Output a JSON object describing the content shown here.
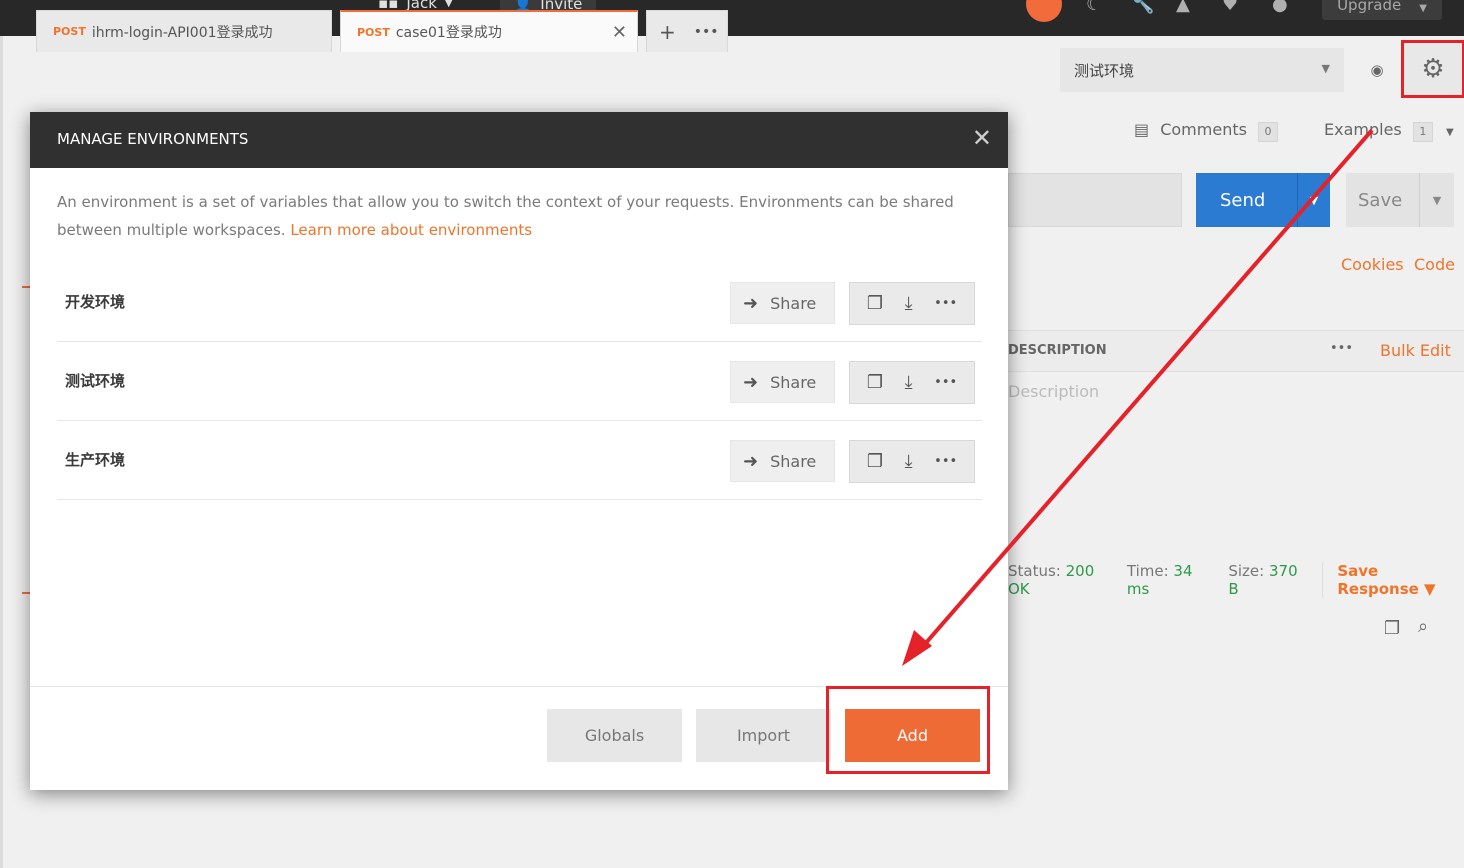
{
  "topbar": {
    "workspace_label": "Jack",
    "invite_label": "Invite",
    "upgrade_label": "Upgrade"
  },
  "tabs": [
    {
      "method": "POST",
      "name": "ihrm-login-API001登录成功"
    },
    {
      "method": "POST",
      "name": "case01登录成功",
      "active": true
    }
  ],
  "environment_selector": {
    "selected": "测试环境"
  },
  "right_panel": {
    "comments_label": "Comments",
    "comments_count": "0",
    "examples_label": "Examples",
    "examples_count": "1",
    "send_label": "Send",
    "save_label": "Save",
    "cookies_label": "Cookies",
    "code_label": "Code",
    "description_header": "DESCRIPTION",
    "bulk_edit_label": "Bulk Edit",
    "description_placeholder": "Description",
    "status_label": "Status:",
    "status_value": "200 OK",
    "time_label": "Time:",
    "time_value": "34 ms",
    "size_label": "Size:",
    "size_value": "370 B",
    "save_response_label": "Save Response"
  },
  "modal": {
    "title": "MANAGE ENVIRONMENTS",
    "intro_text": "An environment is a set of variables that allow you to switch the context of your requests. Environments can be shared between multiple workspaces.",
    "learn_more": "Learn more about environments",
    "environments": [
      {
        "name": "开发环境"
      },
      {
        "name": "测试环境"
      },
      {
        "name": "生产环境"
      }
    ],
    "share_label": "Share",
    "globals_label": "Globals",
    "import_label": "Import",
    "add_label": "Add"
  },
  "colors": {
    "accent": "#ef6b36",
    "send_blue": "#2a7bd1",
    "annotation_red": "#e5222a",
    "header_dark": "#303030"
  },
  "icons": [
    "grid-icon",
    "person-add-icon",
    "sync-icon",
    "satellite-icon",
    "wrench-icon",
    "bell-icon",
    "heart-icon",
    "avatar",
    "eye-icon",
    "gear-icon",
    "comment-icon",
    "close-icon",
    "share-arrow-icon",
    "copy-icon",
    "download-icon",
    "more-icon",
    "search-icon"
  ]
}
